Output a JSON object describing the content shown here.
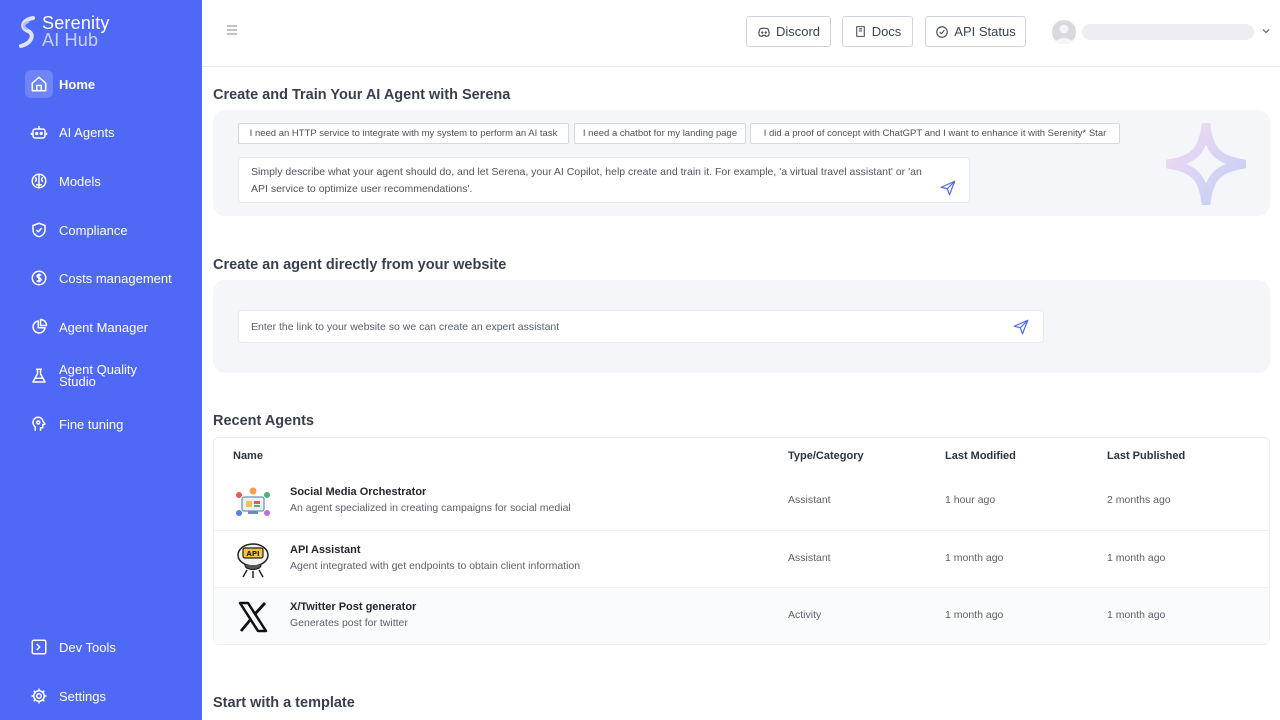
{
  "brand": {
    "line1": "Serenity",
    "line2": "AI Hub"
  },
  "sidebar": {
    "items": [
      {
        "label": "Home",
        "icon": "home-icon",
        "active": true
      },
      {
        "label": "AI Agents",
        "icon": "robot-icon"
      },
      {
        "label": "Models",
        "icon": "brain-icon"
      },
      {
        "label": "Compliance",
        "icon": "shield-check-icon"
      },
      {
        "label": "Costs management",
        "icon": "dollar-circle-icon"
      },
      {
        "label": "Agent Manager",
        "icon": "pie-chart-icon"
      },
      {
        "label": "Agent Quality Studio",
        "icon": "flask-icon"
      },
      {
        "label": "Fine tuning",
        "icon": "head-gear-icon"
      }
    ],
    "bottom_items": [
      {
        "label": "Dev Tools",
        "icon": "terminal-icon"
      },
      {
        "label": "Settings",
        "icon": "gear-icon"
      }
    ]
  },
  "topbar": {
    "discord_label": "Discord",
    "docs_label": "Docs",
    "api_status_label": "API Status"
  },
  "create_train": {
    "title": "Create and Train Your AI Agent with Serena",
    "suggestions": [
      "I need an HTTP service to integrate with my system to perform an AI task",
      "I need a chatbot for my landing page",
      "I did a proof of concept with ChatGPT and I want to enhance it with Serenity* Star"
    ],
    "placeholder": "Simply describe what your agent should do, and let Serena, your AI Copilot, help create and train it. For example, 'a virtual travel assistant' or 'an API service to optimize user recommendations'."
  },
  "website": {
    "title": "Create an agent directly from your website",
    "placeholder": "Enter the link to your website so we can create an expert assistant"
  },
  "recent": {
    "title": "Recent Agents",
    "columns": [
      "Name",
      "Type/Category",
      "Last Modified",
      "Last Published"
    ],
    "rows": [
      {
        "name": "Social Media Orchestrator",
        "description": "An agent specialized in creating campaigns for social medial",
        "type": "Assistant",
        "modified": "1 hour ago",
        "published": "2 months ago",
        "avatar": "social-media-avatar-icon"
      },
      {
        "name": "API Assistant",
        "description": "Agent integrated with get endpoints to obtain client information",
        "type": "Assistant",
        "modified": "1 month ago",
        "published": "1 month ago",
        "avatar": "api-robot-avatar-icon"
      },
      {
        "name": "X/Twitter Post generator",
        "description": "Generates post for twitter",
        "type": "Activity",
        "modified": "1 month ago",
        "published": "1 month ago",
        "avatar": "x-logo-icon"
      }
    ]
  },
  "templates": {
    "title": "Start with a template"
  },
  "colors": {
    "sidebar": "#4f68f5",
    "accent": "#4f68f5",
    "panel": "#f4f6fa"
  }
}
